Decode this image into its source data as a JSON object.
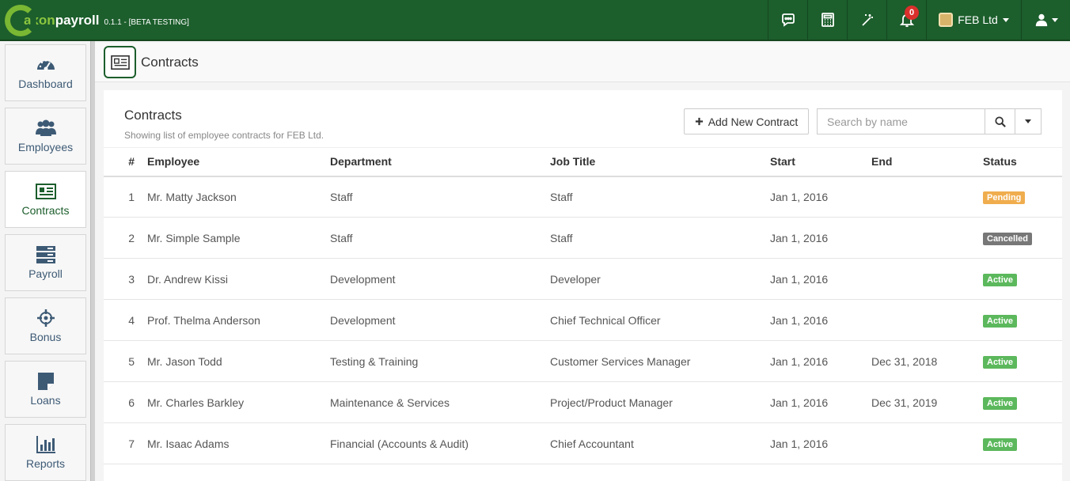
{
  "brand": {
    "name_a": "axon",
    "name_b": "payroll",
    "version": "0.1.1 - [BETA TESTING]"
  },
  "topnav": {
    "icons": [
      "chat-icon",
      "calculator-icon",
      "magic-wand-icon",
      "bell-icon"
    ],
    "notifications_count": "0",
    "company": "FEB Ltd"
  },
  "sidebar": {
    "items": [
      {
        "label": "Dashboard",
        "icon": "dashboard-icon"
      },
      {
        "label": "Employees",
        "icon": "users-icon"
      },
      {
        "label": "Contracts",
        "icon": "contracts-icon",
        "active": true
      },
      {
        "label": "Payroll",
        "icon": "payroll-icon"
      },
      {
        "label": "Bonus",
        "icon": "bonus-icon"
      },
      {
        "label": "Loans",
        "icon": "loans-icon"
      },
      {
        "label": "Reports",
        "icon": "reports-icon"
      }
    ]
  },
  "page": {
    "title": "Contracts"
  },
  "panel": {
    "title": "Contracts",
    "subtitle": "Showing list of employee contracts for FEB Ltd.",
    "add_button": "Add New Contract",
    "search_placeholder": "Search by name"
  },
  "table": {
    "headers": [
      "#",
      "Employee",
      "Department",
      "Job Title",
      "Start",
      "End",
      "Status"
    ],
    "rows": [
      {
        "num": "1",
        "employee": "Mr. Matty Jackson",
        "department": "Staff",
        "job": "Staff",
        "start": "Jan 1, 2016",
        "end": "",
        "status": "Pending"
      },
      {
        "num": "2",
        "employee": "Mr. Simple Sample",
        "department": "Staff",
        "job": "Staff",
        "start": "Jan 1, 2016",
        "end": "",
        "status": "Cancelled"
      },
      {
        "num": "3",
        "employee": "Dr. Andrew Kissi",
        "department": "Development",
        "job": "Developer",
        "start": "Jan 1, 2016",
        "end": "",
        "status": "Active"
      },
      {
        "num": "4",
        "employee": "Prof. Thelma Anderson",
        "department": "Development",
        "job": "Chief Technical Officer",
        "start": "Jan 1, 2016",
        "end": "",
        "status": "Active"
      },
      {
        "num": "5",
        "employee": "Mr. Jason Todd",
        "department": "Testing & Training",
        "job": "Customer Services Manager",
        "start": "Jan 1, 2016",
        "end": "Dec 31, 2018",
        "status": "Active"
      },
      {
        "num": "6",
        "employee": "Mr. Charles Barkley",
        "department": "Maintenance & Services",
        "job": "Project/Product Manager",
        "start": "Jan 1, 2016",
        "end": "Dec 31, 2019",
        "status": "Active"
      },
      {
        "num": "7",
        "employee": "Mr. Isaac Adams",
        "department": "Financial (Accounts & Audit)",
        "job": "Chief Accountant",
        "start": "Jan 1, 2016",
        "end": "",
        "status": "Active"
      }
    ]
  },
  "colors": {
    "brand_green": "#1c5e2c",
    "pending": "#f0ad4e",
    "cancelled": "#777777",
    "active": "#5cb85c"
  }
}
